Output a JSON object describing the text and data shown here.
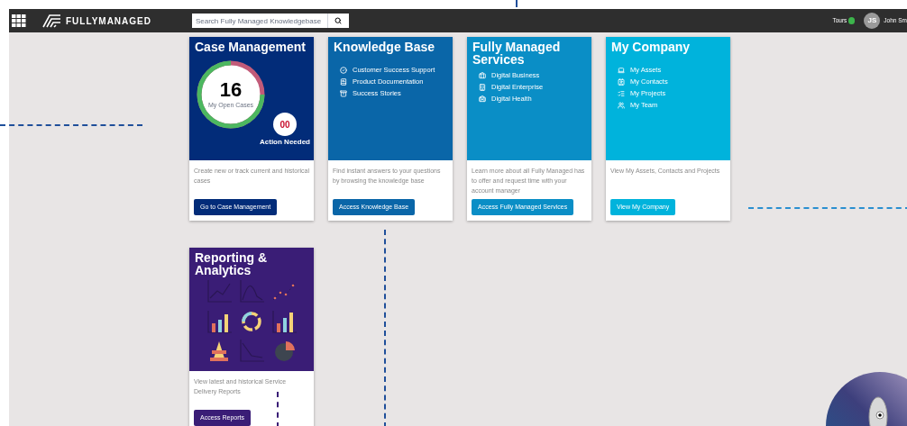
{
  "header": {
    "brand": "FULLYMANAGED",
    "search": {
      "placeholder": "Search Fully Managed Knowledgebase"
    },
    "tours": {
      "label": "Tours",
      "on": true
    },
    "user": {
      "initials": "JS",
      "name": "John Sm"
    }
  },
  "cards": [
    {
      "kind": "cases",
      "title": "Case Management",
      "color": "#022c79",
      "open_cases": {
        "count": "16",
        "label": "My Open Cases"
      },
      "action_needed": {
        "count": "00",
        "label": "Action Needed"
      },
      "description": "Create new or track current and historical cases",
      "button": "Go to Case Management"
    },
    {
      "kind": "list",
      "title": "Knowledge Base",
      "color": "#0a66a8",
      "links": [
        "Customer Success Support",
        "Product Documentation",
        "Success Stories"
      ],
      "description": "Find instant answers to your questions by browsing the knowledge base",
      "button": "Access Knowledge Base"
    },
    {
      "kind": "list",
      "title": "Fully Managed Services",
      "color": "#0a8ec6",
      "links": [
        "Digital Business",
        "Digital Enterprise",
        "Digital Health"
      ],
      "description": "Learn more about all Fully Managed has to offer and request time with your account manager",
      "button": "Access Fully Managed Services"
    },
    {
      "kind": "list",
      "title": "My Company",
      "color": "#00b3dc",
      "links": [
        "My Assets",
        "My Contacts",
        "My Projects",
        "My Team"
      ],
      "description": "View My Assets, Contacts and Projects",
      "button": "View My Company"
    },
    {
      "kind": "reports",
      "title": "Reporting & Analytics",
      "color": "#3a1d76",
      "description": "View latest and historical Service Delivery Reports",
      "button": "Access Reports"
    }
  ]
}
